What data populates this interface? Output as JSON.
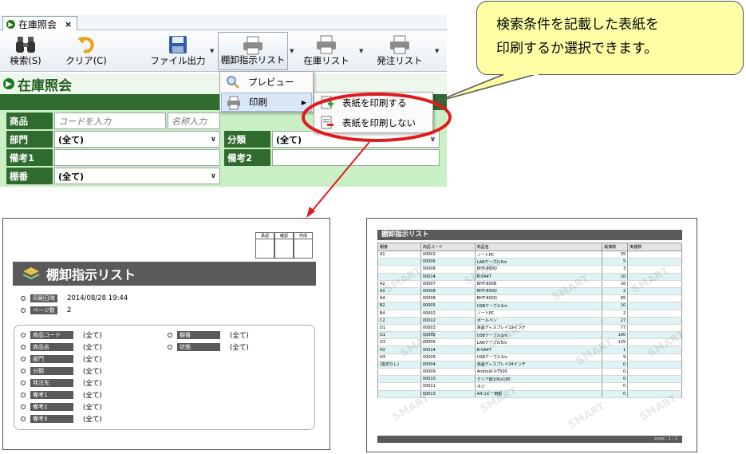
{
  "tab": {
    "label": "在庫照会",
    "close": "×"
  },
  "ribbon": {
    "search": "検索(S)",
    "clear": "クリア(C)",
    "file_output": "ファイル出力",
    "tana_list": "棚卸指示リスト",
    "stock_list": "在庫リスト",
    "order_list": "発注リスト"
  },
  "page_title": "在庫照会",
  "form": {
    "product_label": "商品",
    "code_placeholder": "コードを入力",
    "name_placeholder": "名称入力",
    "dept_label": "部門",
    "dept_value": "(全て)",
    "category_label": "分類",
    "category_value": "(全て)",
    "note1_label": "備考1",
    "note2_label": "備考2",
    "shelf_label": "棚番",
    "shelf_value": "(全て)"
  },
  "menu": {
    "preview": "プレビュー",
    "print": "印刷",
    "print_cover": "表紙を印刷する",
    "no_cover": "表紙を印刷しない"
  },
  "callout": {
    "line1": "検索条件を記載した表紙を",
    "line2": "印刷するか選択できます。"
  },
  "cover": {
    "stamps": [
      "承認",
      "確認",
      "作成"
    ],
    "title": "棚卸指示リスト",
    "print_date_label": "印刷日時",
    "print_date": "2014/08/28 19:44",
    "pages_label": "ページ数",
    "pages": "2",
    "conditions_left": [
      {
        "label": "商品コード",
        "value": "(全て)"
      },
      {
        "label": "商品名",
        "value": "(全て)"
      },
      {
        "label": "部門",
        "value": "(全て)"
      },
      {
        "label": "分類",
        "value": "(全て)"
      },
      {
        "label": "発注先",
        "value": "(全て)"
      },
      {
        "label": "備考1",
        "value": "(全て)"
      },
      {
        "label": "備考2",
        "value": "(全て)"
      },
      {
        "label": "備考3",
        "value": "(全て)"
      }
    ],
    "conditions_right": [
      {
        "label": "棚番",
        "value": "(全て)"
      },
      {
        "label": "状態",
        "value": "(全て)"
      }
    ]
  },
  "list_report": {
    "title": "棚卸指示リスト",
    "headers": [
      "棚番",
      "商品コード",
      "商品名",
      "帳簿数",
      "実棚数"
    ],
    "rows": [
      [
        "A1",
        "00002",
        "ノートPC",
        "55",
        ""
      ],
      [
        "",
        "00006",
        "LANケーブル5m",
        "5",
        ""
      ],
      [
        "",
        "00008",
        "BHT-800Q",
        "3",
        ""
      ],
      [
        "",
        "00014",
        "B-SA4T",
        "10",
        ""
      ],
      [
        "A2",
        "00007",
        "BHT-800B",
        "16",
        ""
      ],
      [
        "A3",
        "00008",
        "BHT-800Q",
        "2",
        ""
      ],
      [
        "A4",
        "00008",
        "BHT-800Q",
        "65",
        ""
      ],
      [
        "B2",
        "00005",
        "USBケーブル1m",
        "10",
        ""
      ],
      [
        "B4",
        "00002",
        "ノートPC",
        "2",
        ""
      ],
      [
        "C2",
        "00012",
        "ボールペン",
        "27",
        ""
      ],
      [
        "D1",
        "00003",
        "液晶ディスプレイ19インチ",
        "77",
        ""
      ],
      [
        "G1",
        "00005",
        "USBケーブル1m",
        "100",
        ""
      ],
      [
        "G3",
        "00006",
        "LANケーブル5m",
        "135",
        ""
      ],
      [
        "H2",
        "00014",
        "B-SA4T",
        "1",
        ""
      ],
      [
        "H3",
        "00005",
        "USBケーブル1m",
        "9",
        ""
      ],
      [
        "(指定なし)",
        "00004",
        "液晶ディスプレイ24インチ",
        "0",
        ""
      ],
      [
        "",
        "00009",
        "Android V-T500",
        "0",
        ""
      ],
      [
        "",
        "00010",
        "クリア紙100x180",
        "0",
        ""
      ],
      [
        "",
        "00011",
        "ネジ",
        "0",
        ""
      ],
      [
        "",
        "00013",
        "A4コピー用紙",
        "0",
        ""
      ]
    ],
    "footer": "page : 1 / 2",
    "watermark": "SMART"
  }
}
